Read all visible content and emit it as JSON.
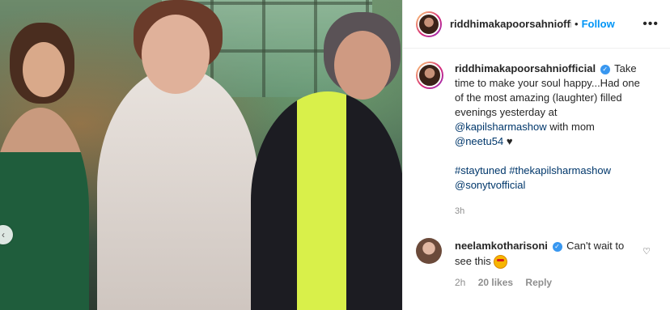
{
  "post": {
    "username": "riddhimakapoorsahniofficial",
    "header_username": "riddhimakapoorsahnioffic",
    "follow_label": "Follow",
    "more_label": "•••",
    "separator": "•"
  },
  "caption": {
    "username": "riddhimakapoorsahniofficial",
    "text_1": "Take time to make your soul happy...Had one of the most amazing (laughter) filled evenings yesterday at",
    "mention_1": "@kapilsharmashow",
    "text_2": "with mom",
    "mention_2": "@neetu54",
    "heart": "♥",
    "hashtag_1": "#staytuned",
    "hashtag_2": "#thekapilsharmashow",
    "mention_3": "@sonytvofficial",
    "time": "3h"
  },
  "comment": {
    "username": "neelamkotharisoni",
    "text": "Can't wait to see this",
    "time": "2h",
    "likes": "20 likes",
    "reply": "Reply",
    "like_icon": "♡"
  },
  "carousel": {
    "prev_icon": "‹"
  }
}
